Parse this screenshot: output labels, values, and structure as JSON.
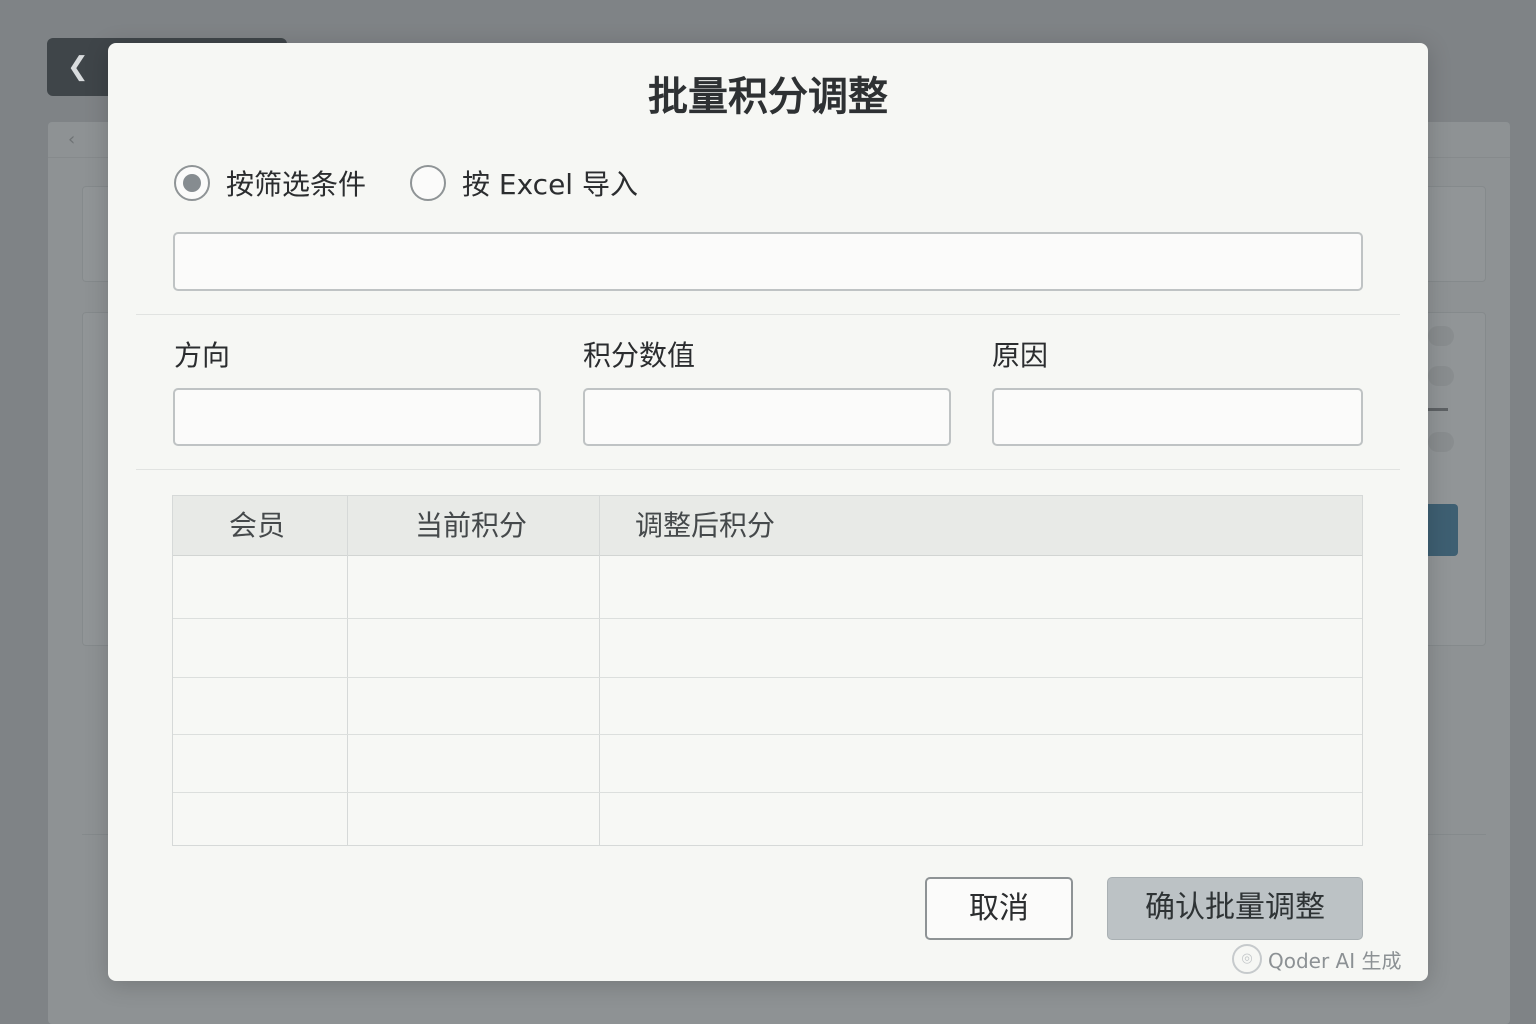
{
  "dialog": {
    "title": "批量积分调整",
    "mode_options": [
      {
        "label": "按筛选条件",
        "selected": true
      },
      {
        "label": "按 Excel 导入",
        "selected": false
      }
    ],
    "filter_value": "",
    "fields": [
      {
        "label": "方向",
        "value": ""
      },
      {
        "label": "积分数值",
        "value": ""
      },
      {
        "label": "原因",
        "value": ""
      }
    ],
    "table": {
      "columns": [
        "会员",
        "当前积分",
        "调整后积分"
      ],
      "rows": [
        [
          "",
          "",
          ""
        ],
        [
          "",
          "",
          ""
        ],
        [
          "",
          "",
          ""
        ],
        [
          "",
          "",
          ""
        ],
        [
          "",
          "",
          ""
        ]
      ]
    },
    "cancel_label": "取消",
    "confirm_label": "确认批量调整"
  },
  "watermark": {
    "text": "Qoder AI 生成",
    "icon": "qoder-logo-icon"
  },
  "colors": {
    "overlay": "#7f8386",
    "dialog_bg": "#f6f7f4",
    "confirm_bg": "#bcc2c5"
  }
}
